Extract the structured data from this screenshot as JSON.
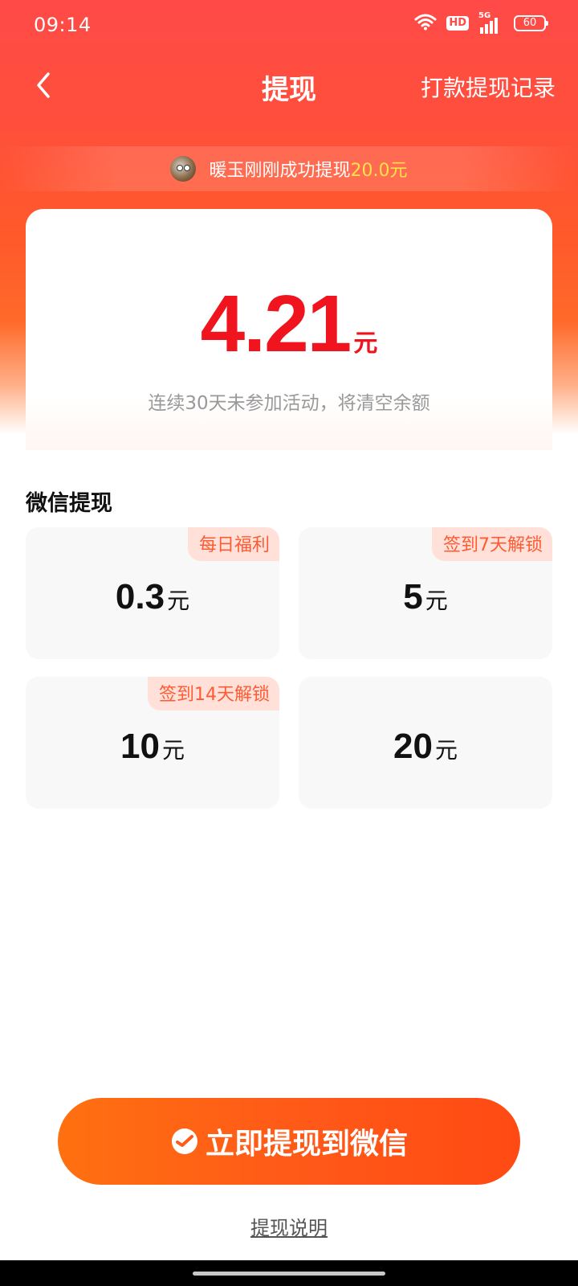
{
  "status_bar": {
    "time": "09:14",
    "hd_label": "HD",
    "network_label": "5G",
    "battery": "60"
  },
  "nav": {
    "title": "提现",
    "record_link": "打款提现记录"
  },
  "ticker": {
    "message": "暖玉刚刚成功提现",
    "amount": "20.0元"
  },
  "balance": {
    "amount": "4.21",
    "unit": "元",
    "note": "连续30天未参加活动，将清空余额"
  },
  "wechat_section": {
    "title": "微信提现",
    "options": [
      {
        "badge": "每日福利",
        "value": "0.3",
        "unit": "元"
      },
      {
        "badge": "签到7天解锁",
        "value": "5",
        "unit": "元"
      },
      {
        "badge": "签到14天解锁",
        "value": "10",
        "unit": "元"
      },
      {
        "badge": "",
        "value": "20",
        "unit": "元"
      }
    ]
  },
  "withdraw_button": {
    "label": "立即提现到微信"
  },
  "help_link": "提现说明",
  "colors": {
    "brand_red": "#ff4a48",
    "amount_red": "#f0141e",
    "button_orange": "#ff5a18",
    "badge_bg": "#ffe1d9",
    "badge_text": "#ff5a32",
    "ticker_highlight": "#ffe24a"
  }
}
